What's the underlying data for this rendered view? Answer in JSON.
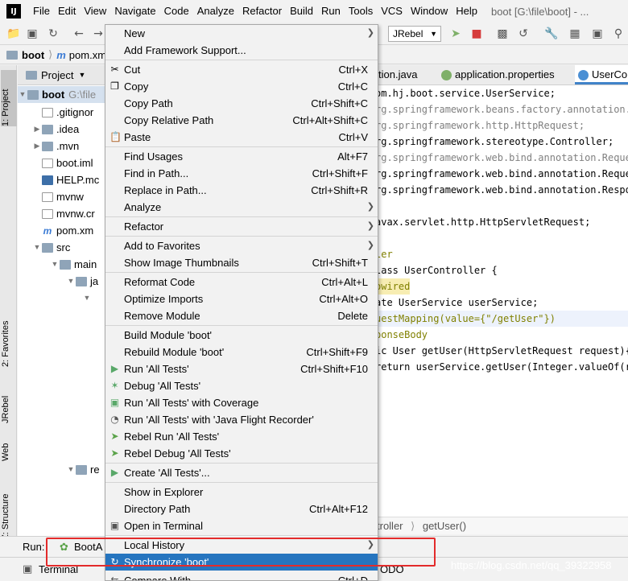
{
  "title_bar": {
    "app": "IJ",
    "title": "boot [G:\\file\\boot] - ..."
  },
  "menubar": [
    "File",
    "Edit",
    "View",
    "Navigate",
    "Code",
    "Analyze",
    "Refactor",
    "Build",
    "Run",
    "Tools",
    "VCS",
    "Window",
    "Help"
  ],
  "toolbar": {
    "run_config": "JRebel"
  },
  "navbar": {
    "project": "boot",
    "file": "pom.xm"
  },
  "left_stripe": {
    "project": "1: Project",
    "favorites": "2: Favorites",
    "jrebel": "JRebel",
    "web": "Web",
    "structure": "Z: Structure"
  },
  "project_panel": {
    "header": "Project",
    "root_name": "boot",
    "root_path": "G:\\file",
    "items": [
      ".gitignor",
      ".idea",
      ".mvn",
      "boot.iml",
      "HELP.mc",
      "mvnw",
      "mvnw.cr",
      "pom.xm",
      "src",
      "main",
      "ja",
      "re"
    ]
  },
  "editor_tabs": [
    "tion.java",
    "application.properties",
    "UserCo"
  ],
  "code_lines": [
    {
      "t": "om.hj.boot.service.UserService;"
    },
    {
      "t": "rg.springframework.beans.factory.annotation.A"
    },
    {
      "t": "rg.springframework.http.HttpRequest;"
    },
    {
      "t": "rg.springframework.stereotype.Controller;"
    },
    {
      "t": "rg.springframework.web.bind.annotation.Reques"
    },
    {
      "t": "rg.springframework.web.bind.annotation.Reques"
    },
    {
      "t": "rg.springframework.web.bind.annotation.Respon"
    },
    {
      "t": ""
    },
    {
      "t": "avax.servlet.http.HttpServletRequest;"
    },
    {
      "t": ""
    },
    {
      "t": "ler"
    },
    {
      "t": "lass UserController {"
    },
    {
      "t": "owired"
    },
    {
      "t": "ate UserService userService;"
    },
    {
      "t": "uestMapping(value={\"/getUser\"})"
    },
    {
      "t": "ponseBody"
    },
    {
      "t": "ic User getUser(HttpServletRequest request){"
    },
    {
      "t": "return userService.getUser(Integer.valueOf(re"
    }
  ],
  "editor_breadcrumb": {
    "a": "troller",
    "b": "getUser()"
  },
  "run_bar": {
    "label": "Run:",
    "config": "BootA"
  },
  "bottom_bar": {
    "terminal": "Terminal",
    "todo": "ODO"
  },
  "watermark": "https://blog.csdn.net/qq_39322958",
  "context_menu": {
    "items": [
      {
        "label": "New",
        "shortcut": "",
        "submenu": true,
        "icon": ""
      },
      {
        "label": "Add Framework Support...",
        "shortcut": "",
        "submenu": false,
        "icon": ""
      },
      {
        "label": "Cut",
        "shortcut": "Ctrl+X",
        "submenu": false,
        "icon": "scissors-icon"
      },
      {
        "label": "Copy",
        "shortcut": "Ctrl+C",
        "submenu": false,
        "icon": "copy-icon"
      },
      {
        "label": "Copy Path",
        "shortcut": "Ctrl+Shift+C",
        "submenu": false,
        "icon": ""
      },
      {
        "label": "Copy Relative Path",
        "shortcut": "Ctrl+Alt+Shift+C",
        "submenu": false,
        "icon": ""
      },
      {
        "label": "Paste",
        "shortcut": "Ctrl+V",
        "submenu": false,
        "icon": "paste-icon"
      },
      {
        "label": "Find Usages",
        "shortcut": "Alt+F7",
        "submenu": false,
        "icon": ""
      },
      {
        "label": "Find in Path...",
        "shortcut": "Ctrl+Shift+F",
        "submenu": false,
        "icon": ""
      },
      {
        "label": "Replace in Path...",
        "shortcut": "Ctrl+Shift+R",
        "submenu": false,
        "icon": ""
      },
      {
        "label": "Analyze",
        "shortcut": "",
        "submenu": true,
        "icon": ""
      },
      {
        "label": "Refactor",
        "shortcut": "",
        "submenu": true,
        "icon": ""
      },
      {
        "label": "Add to Favorites",
        "shortcut": "",
        "submenu": true,
        "icon": ""
      },
      {
        "label": "Show Image Thumbnails",
        "shortcut": "Ctrl+Shift+T",
        "submenu": false,
        "icon": ""
      },
      {
        "label": "Reformat Code",
        "shortcut": "Ctrl+Alt+L",
        "submenu": false,
        "icon": ""
      },
      {
        "label": "Optimize Imports",
        "shortcut": "Ctrl+Alt+O",
        "submenu": false,
        "icon": ""
      },
      {
        "label": "Remove Module",
        "shortcut": "Delete",
        "submenu": false,
        "icon": ""
      },
      {
        "label": "Build Module 'boot'",
        "shortcut": "",
        "submenu": false,
        "icon": ""
      },
      {
        "label": "Rebuild Module 'boot'",
        "shortcut": "Ctrl+Shift+F9",
        "submenu": false,
        "icon": ""
      },
      {
        "label": "Run 'All Tests'",
        "shortcut": "Ctrl+Shift+F10",
        "submenu": false,
        "icon": "run-icon"
      },
      {
        "label": "Debug 'All Tests'",
        "shortcut": "",
        "submenu": false,
        "icon": "debug-icon"
      },
      {
        "label": "Run 'All Tests' with Coverage",
        "shortcut": "",
        "submenu": false,
        "icon": "coverage-icon"
      },
      {
        "label": "Run 'All Tests' with 'Java Flight Recorder'",
        "shortcut": "",
        "submenu": false,
        "icon": "flight-recorder-icon"
      },
      {
        "label": "Rebel Run 'All Tests'",
        "shortcut": "",
        "submenu": false,
        "icon": "rebel-run-icon"
      },
      {
        "label": "Rebel Debug 'All Tests'",
        "shortcut": "",
        "submenu": false,
        "icon": "rebel-debug-icon"
      },
      {
        "label": "Create 'All Tests'...",
        "shortcut": "",
        "submenu": false,
        "icon": "create-test-icon"
      },
      {
        "label": "Show in Explorer",
        "shortcut": "",
        "submenu": false,
        "icon": ""
      },
      {
        "label": "Directory Path",
        "shortcut": "Ctrl+Alt+F12",
        "submenu": false,
        "icon": ""
      },
      {
        "label": "Open in Terminal",
        "shortcut": "",
        "submenu": false,
        "icon": "terminal-icon"
      },
      {
        "label": "Local History",
        "shortcut": "",
        "submenu": true,
        "icon": ""
      },
      {
        "label": "Synchronize 'boot'",
        "shortcut": "",
        "submenu": false,
        "icon": "sync-icon"
      },
      {
        "label": "Compare With...",
        "shortcut": "Ctrl+D",
        "submenu": false,
        "icon": ""
      }
    ]
  },
  "colors": {
    "selection": "#2675bf",
    "highlight_box": "#e32b2b",
    "jrebel_green": "#5ba34a"
  }
}
